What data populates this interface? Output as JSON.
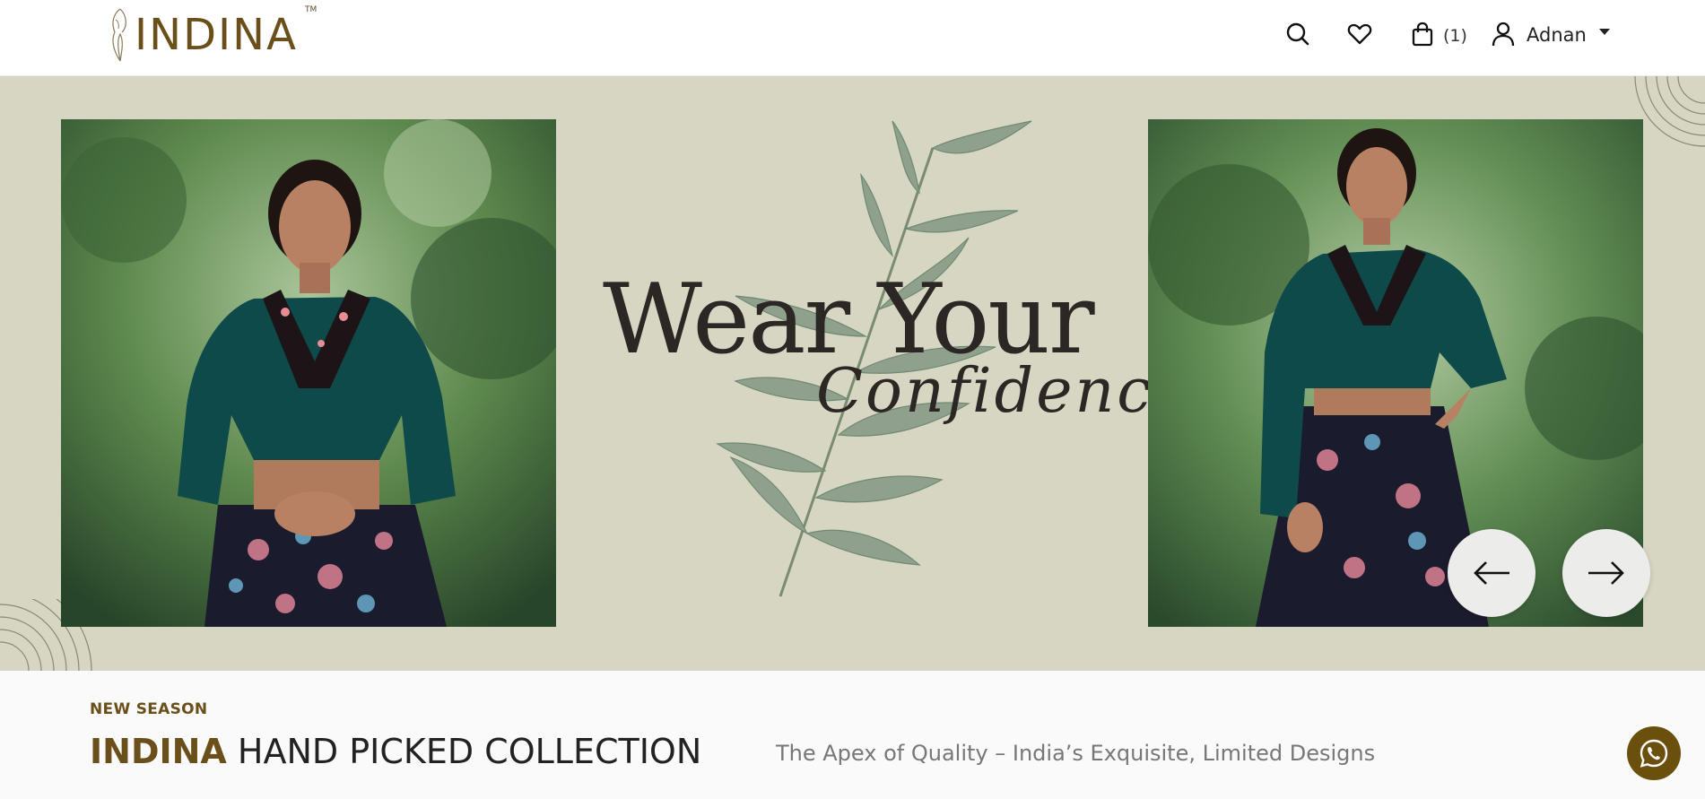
{
  "header": {
    "logo_text": "INDINA",
    "logo_tm": "TM",
    "cart_count": "(1)",
    "user_name": "Adnan"
  },
  "hero": {
    "headline_line1": "Wear Your",
    "headline_line2": "Confidence"
  },
  "collection": {
    "season_label": "NEW SEASON",
    "title_brand": "INDINA",
    "title_rest": " HAND PICKED COLLECTION",
    "tagline": "The Apex of Quality – India’s Exquisite, Limited Designs"
  },
  "colors": {
    "brand_gold": "#6b4f1a",
    "hero_bg": "#d6d6c2",
    "whatsapp_bg": "#6b4f0d"
  },
  "icons": [
    "search-icon",
    "heart-icon",
    "bag-icon",
    "user-icon",
    "arrow-left-icon",
    "arrow-right-icon",
    "whatsapp-icon",
    "leaf-branch-icon"
  ]
}
